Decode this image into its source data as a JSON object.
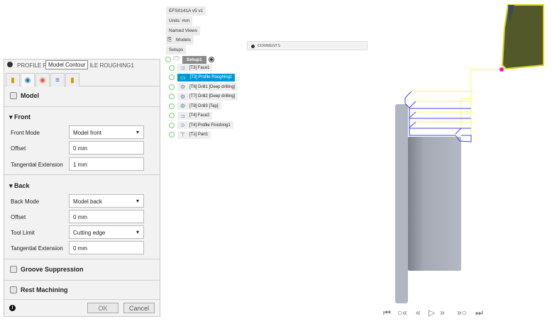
{
  "dialog": {
    "title": "PROFILE ROUGHING: PROFILE ROUGHING1",
    "title_left": "PROFILE R",
    "title_right": "ILE ROUGHING1",
    "tooltip": "Model Contour",
    "model_label": "Model",
    "front": {
      "header": "Front",
      "mode_label": "Front Mode",
      "mode_value": "Model front",
      "offset_label": "Offset",
      "offset_value": "0 mm",
      "tangential_label": "Tangential Extension",
      "tangential_value": "1 mm"
    },
    "back": {
      "header": "Back",
      "mode_label": "Back Mode",
      "mode_value": "Model back",
      "offset_label": "Offset",
      "offset_value": "0 mm",
      "tool_limit_label": "Tool Limit",
      "tool_limit_value": "Cutting edge",
      "tangential_label": "Tangential Extension",
      "tangential_value": "0 mm"
    },
    "groove_label": "Groove Suppression",
    "rest_label": "Rest Machining",
    "ok": "OK",
    "cancel": "Cancel"
  },
  "browser": {
    "doc": "EFS0141A v5 v1",
    "units": "Units: mm",
    "named_views": "Named Views",
    "models": "Models",
    "setups": "Setups",
    "setup": "Setup1",
    "ops": [
      {
        "label": "[T3] Face1"
      },
      {
        "label": "[T3] Profile Roughing1",
        "selected": true
      },
      {
        "label": "[T6] Drill1 [Deep drilling]"
      },
      {
        "label": "[T7] Drill2 [Deep drilling]"
      },
      {
        "label": "[T8] Drill3 [Tap]"
      },
      {
        "label": "[T4] Face2"
      },
      {
        "label": "[T4] Profile Finishing1"
      },
      {
        "label": "[T1] Part1"
      }
    ]
  },
  "comments": "COMMENTS",
  "colors": {
    "selected": "#0696d7",
    "toolpath_yellow": "#ffff55",
    "toolpath_blue": "#4444ee",
    "tool": "#53582a",
    "marker": "#ff1493"
  }
}
